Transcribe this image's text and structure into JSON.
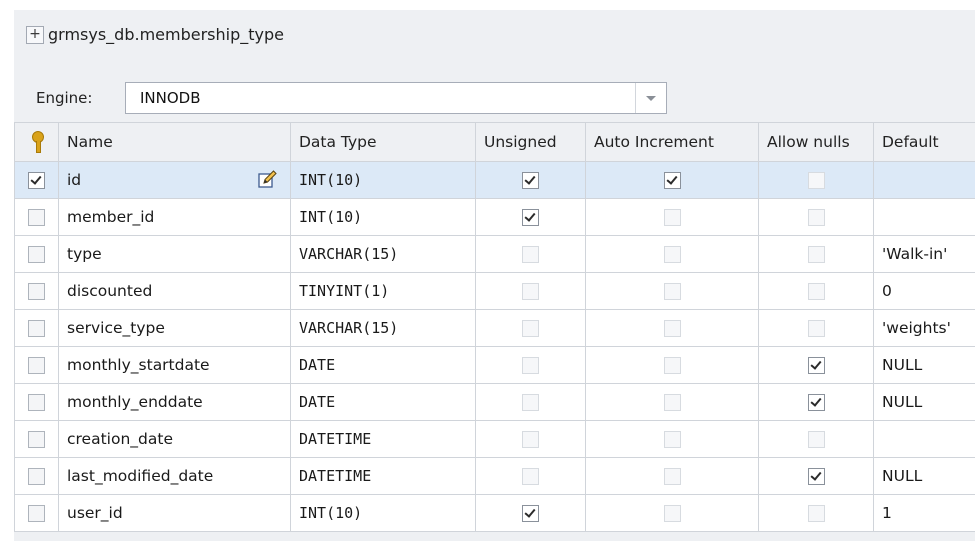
{
  "window": {
    "title": "grmsys_db.membership_type",
    "expand_label": "+"
  },
  "engine": {
    "label": "Engine:",
    "value": "INNODB"
  },
  "columns_header": {
    "name": "Name",
    "data_type": "Data Type",
    "unsigned": "Unsigned",
    "auto_increment": "Auto Increment",
    "allow_nulls": "Allow nulls",
    "default": "Default"
  },
  "rows": [
    {
      "pk": true,
      "name": "id",
      "type": "INT(10)",
      "unsigned": true,
      "ai": true,
      "nulls": false,
      "default": "",
      "selected": true
    },
    {
      "pk": false,
      "name": "member_id",
      "type": "INT(10)",
      "unsigned": true,
      "ai": false,
      "nulls": false,
      "default": "",
      "selected": false
    },
    {
      "pk": false,
      "name": "type",
      "type": "VARCHAR(15)",
      "unsigned": false,
      "ai": false,
      "nulls": false,
      "default": "'Walk-in'",
      "selected": false
    },
    {
      "pk": false,
      "name": "discounted",
      "type": "TINYINT(1)",
      "unsigned": false,
      "ai": false,
      "nulls": false,
      "default": "0",
      "selected": false
    },
    {
      "pk": false,
      "name": "service_type",
      "type": "VARCHAR(15)",
      "unsigned": false,
      "ai": false,
      "nulls": false,
      "default": "'weights'",
      "selected": false
    },
    {
      "pk": false,
      "name": "monthly_startdate",
      "type": "DATE",
      "unsigned": false,
      "ai": false,
      "nulls": true,
      "default": "NULL",
      "selected": false
    },
    {
      "pk": false,
      "name": "monthly_enddate",
      "type": "DATE",
      "unsigned": false,
      "ai": false,
      "nulls": true,
      "default": "NULL",
      "selected": false
    },
    {
      "pk": false,
      "name": "creation_date",
      "type": "DATETIME",
      "unsigned": false,
      "ai": false,
      "nulls": false,
      "default": "",
      "selected": false
    },
    {
      "pk": false,
      "name": "last_modified_date",
      "type": "DATETIME",
      "unsigned": false,
      "ai": false,
      "nulls": true,
      "default": "NULL",
      "selected": false
    },
    {
      "pk": false,
      "name": "user_id",
      "type": "INT(10)",
      "unsigned": true,
      "ai": false,
      "nulls": false,
      "default": "1",
      "selected": false
    }
  ],
  "colors": {
    "selected_row": "#dce9f7",
    "header_bg": "#eef0f3",
    "key_icon": "#d9a21a"
  }
}
